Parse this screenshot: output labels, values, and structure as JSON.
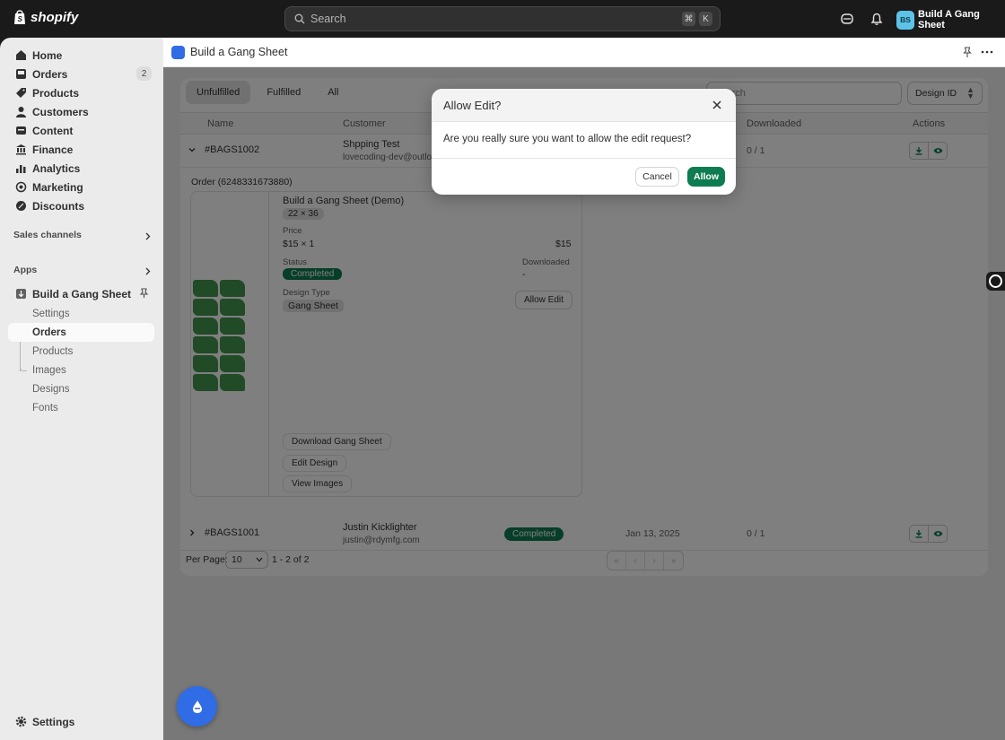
{
  "topbar": {
    "brand": "shopify",
    "search_placeholder": "Search",
    "shortcut_keys": [
      "⌘",
      "K"
    ],
    "store_initials": "BS",
    "store_name": "Build A Gang Sheet"
  },
  "sidebar": {
    "items": [
      {
        "label": "Home",
        "icon": "home-icon"
      },
      {
        "label": "Orders",
        "icon": "inbox-icon",
        "count": "2"
      },
      {
        "label": "Products",
        "icon": "tag-icon"
      },
      {
        "label": "Customers",
        "icon": "person-icon"
      },
      {
        "label": "Content",
        "icon": "content-icon"
      },
      {
        "label": "Finance",
        "icon": "bank-icon"
      },
      {
        "label": "Analytics",
        "icon": "chart-icon"
      },
      {
        "label": "Marketing",
        "icon": "target-icon"
      },
      {
        "label": "Discounts",
        "icon": "discount-icon"
      }
    ],
    "sales_channels_label": "Sales channels",
    "apps_label": "Apps",
    "app_name": "Build a Gang Sheet",
    "app_sub_items": [
      "Settings",
      "Orders",
      "Products",
      "Images",
      "Designs",
      "Fonts"
    ],
    "active_sub_item": "Orders",
    "settings_label": "Settings"
  },
  "app_header": {
    "title": "Build a Gang Sheet"
  },
  "orders": {
    "tabs": [
      "Unfulfilled",
      "Fulfilled",
      "All"
    ],
    "active_tab": "Unfulfilled",
    "search_placeholder": "Search",
    "sort_label": "Design ID",
    "columns": [
      "Name",
      "Customer",
      "Downloaded",
      "Actions"
    ],
    "rows": [
      {
        "id": "#BAGS1002",
        "customer_name": "Shpping Test",
        "customer_email": "lovecoding-dev@outlo",
        "downloaded": "0 / 1"
      },
      {
        "id": "#BAGS1001",
        "customer_name": "Justin Kicklighter",
        "customer_email": "justin@rdymfg.com",
        "status": "Completed",
        "date": "Jan 13, 2025",
        "downloaded": "0 / 1"
      }
    ],
    "detail": {
      "order_label": "Order (6248331673880)",
      "product_name": "Build a Gang Sheet (Demo)",
      "size": "22 × 36",
      "price_label": "Price",
      "price_value": "$15 × 1",
      "price_total": "$15",
      "status_label": "Status",
      "status_value": "Completed",
      "downloaded_label": "Downloaded",
      "downloaded_value": "-",
      "design_type_label": "Design Type",
      "design_type_value": "Gang Sheet",
      "allow_edit_label": "Allow Edit",
      "download_label": "Download Gang Sheet",
      "edit_design_label": "Edit Design",
      "view_images_label": "View Images"
    },
    "pagination": {
      "per_page_label": "Per Page:",
      "per_page_value": "10",
      "range": "1 - 2 of 2"
    }
  },
  "modal": {
    "title": "Allow Edit?",
    "body": "Are you really sure you want to allow the edit request?",
    "cancel_label": "Cancel",
    "allow_label": "Allow"
  },
  "colors": {
    "accent_green": "#0e7c52",
    "app_blue": "#2f6ce5",
    "topbar": "#1a1a1a"
  }
}
